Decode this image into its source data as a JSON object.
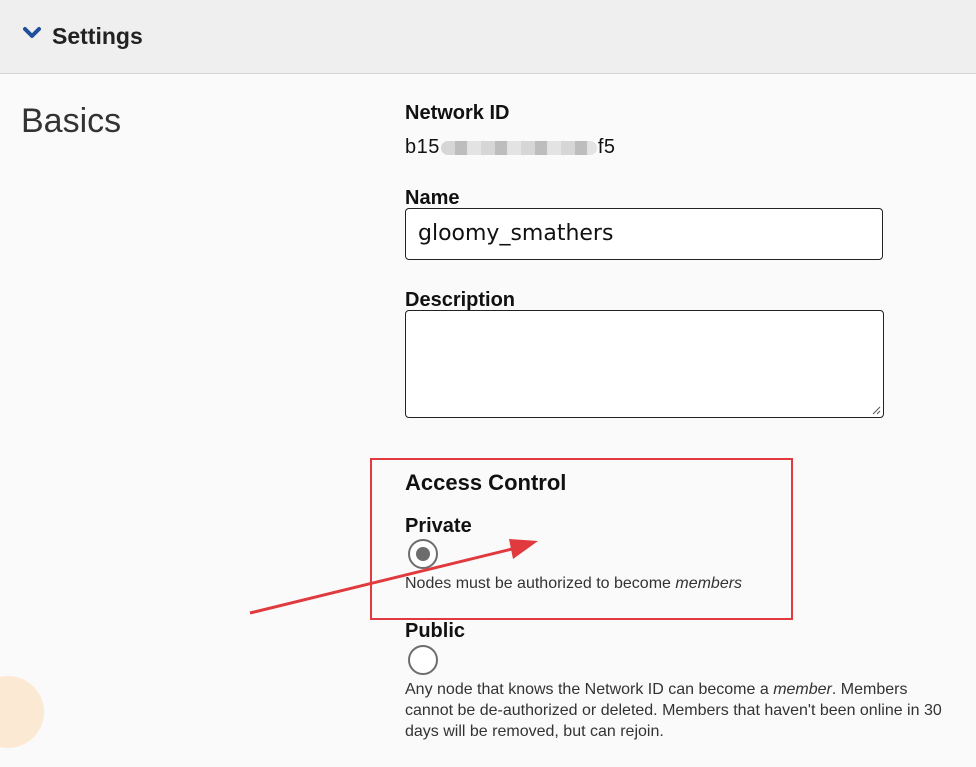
{
  "header": {
    "title": "Settings",
    "toggle_icon": "chevron-down-icon"
  },
  "section": {
    "title": "Basics"
  },
  "network_id": {
    "label": "Network ID",
    "value_prefix": "b15",
    "value_suffix": "f5"
  },
  "name": {
    "label": "Name",
    "value": "gloomy_smathers"
  },
  "description": {
    "label": "Description",
    "value": ""
  },
  "access_control": {
    "title": "Access Control",
    "private": {
      "label": "Private",
      "selected": true,
      "help_before": "Nodes must be authorized to become ",
      "help_em": "members"
    },
    "public": {
      "label": "Public",
      "selected": false,
      "help_1": "Any node that knows the Network ID can become a ",
      "help_em": "member",
      "help_2": ". Members cannot be de-authorized or deleted. Members that haven't been online in 30 days will be removed, but can rejoin."
    }
  },
  "colors": {
    "highlight": "#e0393e",
    "chevron": "#1f4e9c"
  }
}
